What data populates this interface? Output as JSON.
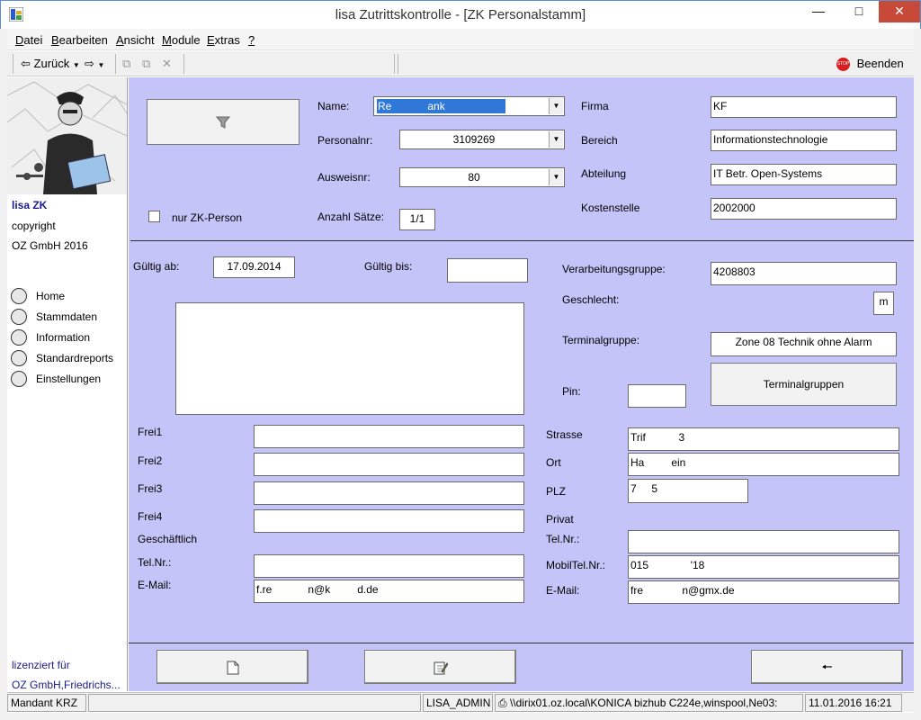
{
  "window": {
    "title": "lisa Zutrittskontrolle - [ZK Personalstamm]"
  },
  "menu": [
    {
      "pre": "",
      "u": "D",
      "post": "atei"
    },
    {
      "pre": "",
      "u": "B",
      "post": "earbeiten"
    },
    {
      "pre": "",
      "u": "A",
      "post": "nsicht"
    },
    {
      "pre": "",
      "u": "M",
      "post": "odule"
    },
    {
      "pre": "",
      "u": "E",
      "post": "xtras"
    },
    {
      "pre": "",
      "u": "?",
      "post": ""
    }
  ],
  "toolbar": {
    "back": "Zurück",
    "exit": "Beenden"
  },
  "sidebar": {
    "app": "lisa ZK",
    "copyright": "copyright",
    "company": "OZ GmbH 2016",
    "nav": [
      "Home",
      "Stammdaten",
      "Information",
      "Standardreports",
      "Einstellungen"
    ],
    "licensed": "lizenziert für",
    "licensee": "OZ GmbH,Friedrichs..."
  },
  "form": {
    "name_label": "Name:",
    "name_value": "Re            ank",
    "personalnr_label": "Personalnr:",
    "personalnr_value": "3109269",
    "ausweisnr_label": "Ausweisnr:",
    "ausweisnr_value": "80",
    "anzahl_label": "Anzahl Sätze:",
    "anzahl_value": "1/1",
    "zk_person_label": "nur ZK-Person",
    "firma_label": "Firma",
    "firma_value": "KF",
    "bereich_label": "Bereich",
    "bereich_value": "Informationstechnologie",
    "abteilung_label": "Abteilung",
    "abteilung_value": "IT Betr. Open-Systems",
    "kostenstelle_label": "Kostenstelle",
    "kostenstelle_value": "2002000",
    "gueltig_ab_label": "Gültig ab:",
    "gueltig_ab_value": "17.09.2014",
    "gueltig_bis_label": "Gültig bis:",
    "gueltig_bis_value": "",
    "verarbeitung_label": "Verarbeitungsgruppe:",
    "verarbeitung_value": "4208803",
    "geschlecht_label": "Geschlecht:",
    "geschlecht_value": "m",
    "terminalgruppe_label": "Terminalgruppe:",
    "terminalgruppe_value": "Zone 08 Technik ohne Alarm",
    "terminalgruppen_button": "Terminalgruppen",
    "pin_label": "Pin:",
    "frei1_label": "Frei1",
    "frei2_label": "Frei2",
    "frei3_label": "Frei3",
    "frei4_label": "Frei4",
    "geschaeftlich_label": "Geschäftlich",
    "tel_label": "Tel.Nr.:",
    "email_label": "E-Mail:",
    "email_value": "f.re            n@k         d.de",
    "strasse_label": "Strasse",
    "strasse_value": "Trif           3",
    "ort_label": "Ort",
    "ort_value": "Ha         ein",
    "plz_label": "PLZ",
    "plz_value": "7     5",
    "privat_label": "Privat",
    "priv_tel_label": "Tel.Nr.:",
    "mobil_label": "MobilTel.Nr.:",
    "mobil_value": "015              '18",
    "priv_email_label": "E-Mail:",
    "priv_email_value": "fre             n@gmx.de"
  },
  "status": {
    "mandant": "Mandant KRZ",
    "user": "LISA_ADMIN",
    "printer": "\\\\dirix01.oz.local\\KONICA bizhub C224e,winspool,Ne03:",
    "datetime": "11.01.2016 16:21"
  },
  "colors": {
    "panel": "#c4c4f8",
    "close": "#c74a38",
    "exit_icon": "#d42020"
  }
}
